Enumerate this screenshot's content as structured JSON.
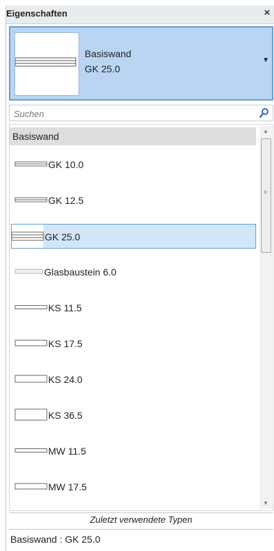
{
  "titlebar": {
    "title": "Eigenschaften",
    "close_symbol": "×"
  },
  "type_selector": {
    "family": "Basiswand",
    "type": "GK 25.0",
    "arrow": "▼"
  },
  "search": {
    "placeholder": "Suchen",
    "value": ""
  },
  "list": {
    "group": "Basiswand",
    "items": [
      {
        "label": "GK 10.0",
        "selected": false
      },
      {
        "label": "GK 12.5",
        "selected": false
      },
      {
        "label": "GK 25.0",
        "selected": true
      },
      {
        "label": "Glasbaustein 6.0",
        "selected": false
      },
      {
        "label": "KS 11.5",
        "selected": false
      },
      {
        "label": "KS 17.5",
        "selected": false
      },
      {
        "label": "KS 24.0",
        "selected": false
      },
      {
        "label": "KS 36.5",
        "selected": false
      },
      {
        "label": "MW 11.5",
        "selected": false
      },
      {
        "label": "MW 17.5",
        "selected": false
      }
    ]
  },
  "recent": {
    "header": "Zuletzt verwendete Typen",
    "item": "Basiswand : GK 25.0"
  },
  "scrollbar": {
    "up": "▲",
    "down": "▼",
    "grip": "≡"
  },
  "colors": {
    "selector_bg": "#b9d5f3",
    "selector_border": "#6a9ed6",
    "selected_row": "#d2e6f8"
  }
}
